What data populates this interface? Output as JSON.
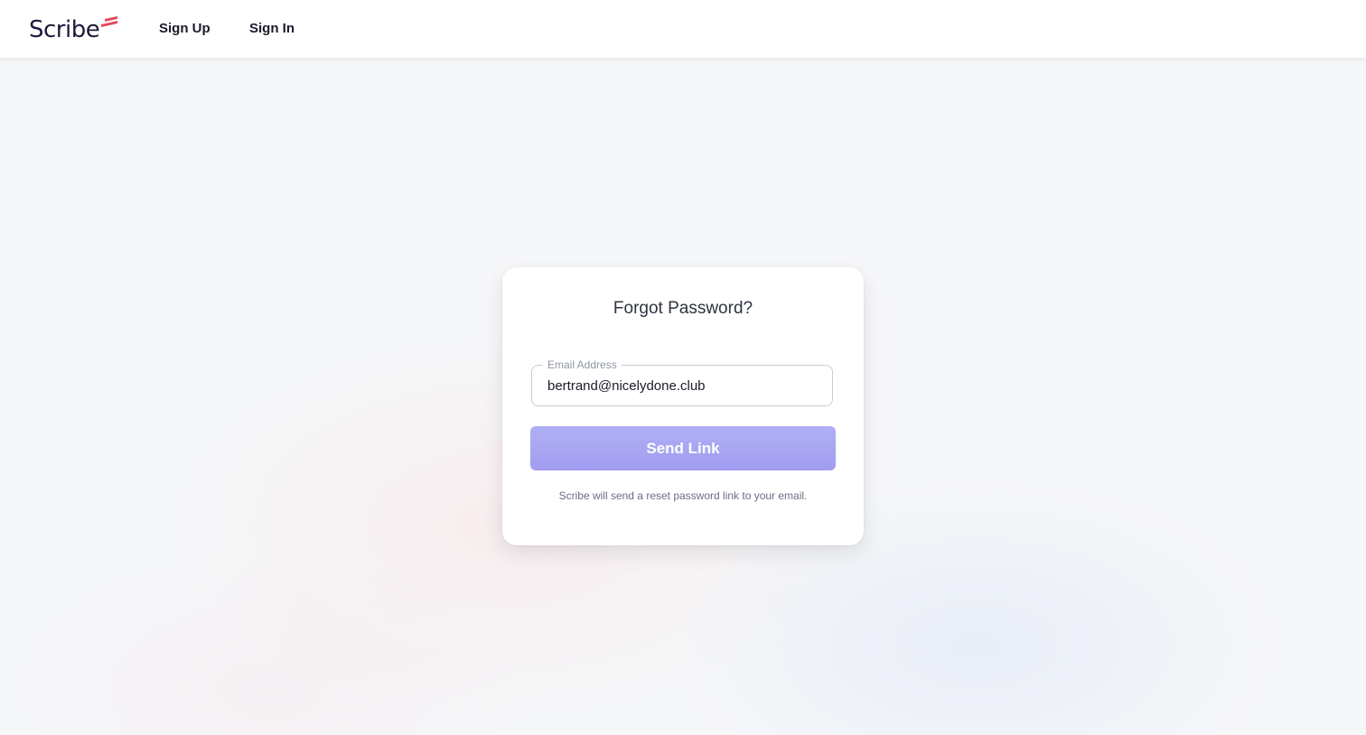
{
  "brand": {
    "name": "Scribe",
    "logo_mark_color": "#e5485d"
  },
  "nav": {
    "sign_up": "Sign Up",
    "sign_in": "Sign In"
  },
  "card": {
    "title": "Forgot Password?",
    "email_label": "Email Address",
    "email_value": "bertrand@nicelydone.club",
    "send_button": "Send Link",
    "helper_text": "Scribe will send a reset password link to your email."
  },
  "colors": {
    "button": "#a7a4f2",
    "text_dark": "#1b1b2a",
    "background": "#f6f7f9"
  }
}
